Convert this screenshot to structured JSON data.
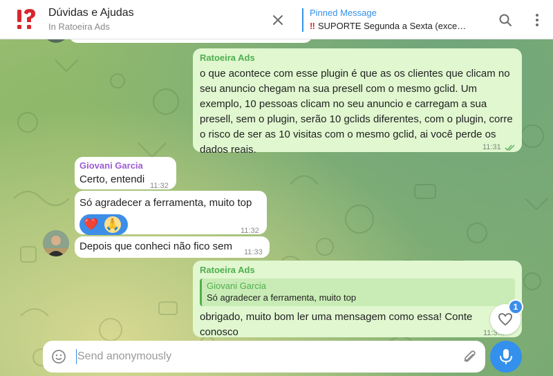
{
  "header": {
    "title": "Dúvidas e Ajudas",
    "subtitle": "In Ratoeira Ads",
    "pinned_title": "Pinned Message",
    "pinned_text": "SUPORTE Segunda a Sexta (exce…",
    "pinned_icon": "double-exclamation-icon"
  },
  "messages": [
    {
      "id": "msg1",
      "direction": "outgoing",
      "sender": "Ratoeira Ads",
      "text": "o que acontece com esse plugin é que as os clientes que clicam no seu anuncio chegam na sua presell com o mesmo gclid. Um exemplo, 10 pessoas clicam no seu anuncio e carregam a sua presell, sem o plugin, serão 10 gclids diferentes, com o plugin, corre o risco de ser as 10 visitas com o mesmo gclid, ai você perde os dados reais.",
      "time": "11:31",
      "status_icon": "double-check-icon"
    },
    {
      "id": "msg2",
      "direction": "incoming",
      "sender": "Giovani Garcia",
      "text": "Certo, entendi",
      "time": "11:32"
    },
    {
      "id": "msg3",
      "direction": "incoming",
      "text": "Só agradecer a ferramenta, muito top",
      "time": "11:32",
      "reactions": [
        {
          "icon": "heart-reaction-icon",
          "glyph": "❤️"
        },
        {
          "icon": "face-reaction-icon",
          "glyph": "🙏"
        }
      ]
    },
    {
      "id": "msg4",
      "direction": "incoming",
      "text": "Depois que conheci não fico sem",
      "time": "11:33"
    },
    {
      "id": "msg5",
      "direction": "outgoing",
      "sender": "Ratoeira Ads",
      "reply_to": {
        "sender": "Giovani Garcia",
        "text": "Só agradecer a ferramenta, muito top"
      },
      "text": "obrigado, muito bom ler uma mensagem como essa! Conte conosco",
      "time": "11:3…"
    }
  ],
  "like_badge": "1",
  "composer": {
    "placeholder": "Send anonymously"
  },
  "colors": {
    "accent": "#3390ec",
    "outgoing_bubble": "#e0f7d0",
    "incoming_bubble": "#ffffff",
    "sender_green": "#4fae4e",
    "sender_purple": "#9c5cd4",
    "logo_red": "#d8262c"
  }
}
